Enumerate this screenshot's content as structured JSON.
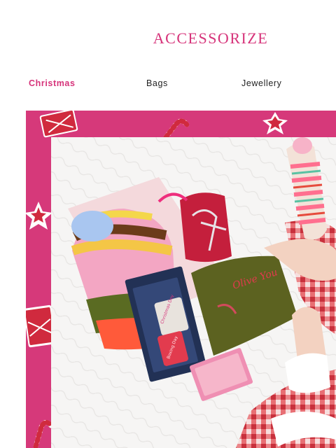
{
  "brand": {
    "name": "ACCESSORIZE",
    "color": "#d6337a"
  },
  "nav": {
    "items": [
      {
        "label": "Christmas",
        "active": true
      },
      {
        "label": "Bags",
        "active": false
      },
      {
        "label": "Jewellery",
        "active": false
      }
    ]
  },
  "hero": {
    "frame_color": "#d6397a",
    "bag_text": "Olive You",
    "socks_box_labels": [
      "Christmas Day",
      "Boxing Day"
    ]
  }
}
